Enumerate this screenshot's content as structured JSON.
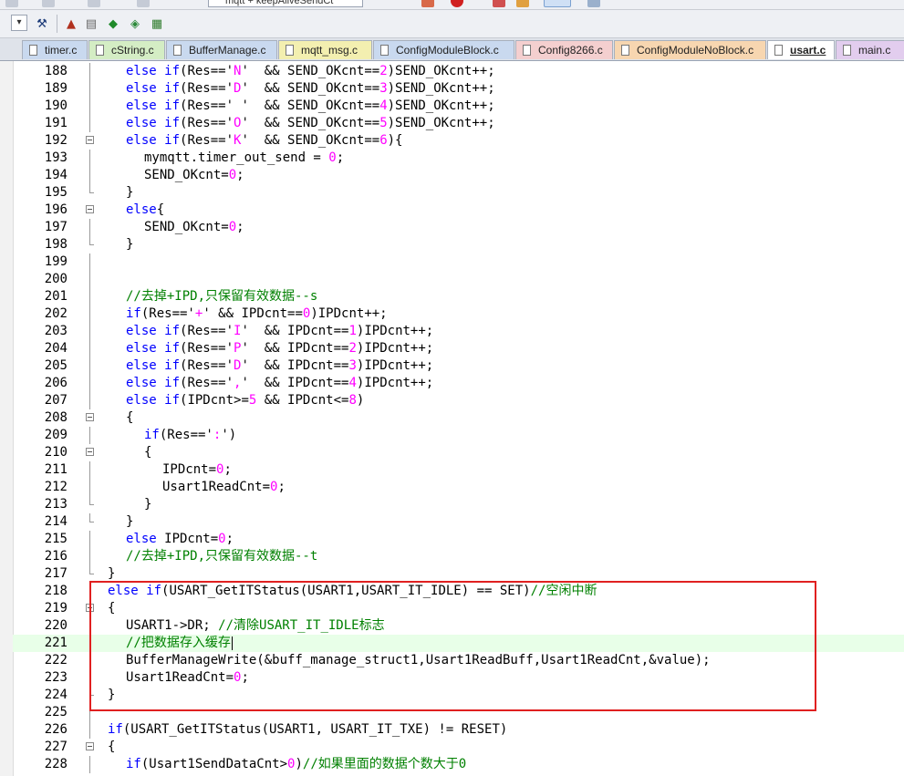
{
  "toolbar_top": {
    "target_combo": "mqtt + keepAliveSendCt"
  },
  "toolbar": {
    "buttons": [
      {
        "name": "dropdown-button",
        "glyph": "▾"
      },
      {
        "name": "options-wand-icon",
        "glyph": "⚒"
      },
      {
        "name": "manage-components-icon",
        "glyph": "▲"
      },
      {
        "name": "file-extensions-icon",
        "glyph": "▤"
      },
      {
        "name": "green-diamond-icon",
        "glyph": "◆"
      },
      {
        "name": "select-packs-icon",
        "glyph": "◈"
      },
      {
        "name": "pack-installer-icon",
        "glyph": "▦"
      }
    ]
  },
  "tabs": [
    {
      "label": "timer.c",
      "color": "#c9d9ef",
      "active": false
    },
    {
      "label": "cString.c",
      "color": "#d4edc4",
      "active": false
    },
    {
      "label": "BufferManage.c",
      "color": "#c9d9ef",
      "active": false
    },
    {
      "label": "mqtt_msg.c",
      "color": "#f3efb0",
      "active": false
    },
    {
      "label": "ConfigModuleBlock.c",
      "color": "#c9d9ef",
      "active": false
    },
    {
      "label": "Config8266.c",
      "color": "#f4cfcf",
      "active": false
    },
    {
      "label": "ConfigModuleNoBlock.c",
      "color": "#f7d6b0",
      "active": false
    },
    {
      "label": "usart.c",
      "color": "#ffffff",
      "active": true
    },
    {
      "label": "main.c",
      "color": "#e2cdee",
      "active": false
    }
  ],
  "colors": {
    "keyword": "#0000ff",
    "number": "#ff00ff",
    "comment": "#008000",
    "highlight_box": "#e02020",
    "current_line": "#e8ffe8"
  },
  "lines": [
    {
      "n": "188",
      "i": 2,
      "f": "v",
      "t": [
        [
          "kw",
          "else if"
        ],
        [
          "tx",
          "(Res=='"
        ],
        [
          "num",
          "N"
        ],
        [
          "tx",
          "'  && SEND_OKcnt=="
        ],
        [
          "num",
          "2"
        ],
        [
          "tx",
          ")SEND_OKcnt++;"
        ]
      ]
    },
    {
      "n": "189",
      "i": 2,
      "f": "v",
      "t": [
        [
          "kw",
          "else if"
        ],
        [
          "tx",
          "(Res=='"
        ],
        [
          "num",
          "D"
        ],
        [
          "tx",
          "'  && SEND_OKcnt=="
        ],
        [
          "num",
          "3"
        ],
        [
          "tx",
          ")SEND_OKcnt++;"
        ]
      ]
    },
    {
      "n": "190",
      "i": 2,
      "f": "v",
      "t": [
        [
          "kw",
          "else if"
        ],
        [
          "tx",
          "(Res=='"
        ],
        [
          "num",
          " "
        ],
        [
          "tx",
          "'  && SEND_OKcnt=="
        ],
        [
          "num",
          "4"
        ],
        [
          "tx",
          ")SEND_OKcnt++;"
        ]
      ]
    },
    {
      "n": "191",
      "i": 2,
      "f": "v",
      "t": [
        [
          "kw",
          "else if"
        ],
        [
          "tx",
          "(Res=='"
        ],
        [
          "num",
          "O"
        ],
        [
          "tx",
          "'  && SEND_OKcnt=="
        ],
        [
          "num",
          "5"
        ],
        [
          "tx",
          ")SEND_OKcnt++;"
        ]
      ]
    },
    {
      "n": "192",
      "i": 2,
      "f": "box",
      "t": [
        [
          "kw",
          "else if"
        ],
        [
          "tx",
          "(Res=='"
        ],
        [
          "num",
          "K"
        ],
        [
          "tx",
          "'  && SEND_OKcnt=="
        ],
        [
          "num",
          "6"
        ],
        [
          "tx",
          "){"
        ]
      ]
    },
    {
      "n": "193",
      "i": 3,
      "f": "v",
      "t": [
        [
          "tx",
          "mymqtt.timer_out_send = "
        ],
        [
          "num",
          "0"
        ],
        [
          "tx",
          ";"
        ]
      ]
    },
    {
      "n": "194",
      "i": 3,
      "f": "v",
      "t": [
        [
          "tx",
          "SEND_OKcnt="
        ],
        [
          "num",
          "0"
        ],
        [
          "tx",
          ";"
        ]
      ]
    },
    {
      "n": "195",
      "i": 2,
      "f": "end",
      "t": [
        [
          "tx",
          "}"
        ]
      ]
    },
    {
      "n": "196",
      "i": 2,
      "f": "box",
      "t": [
        [
          "kw",
          "else"
        ],
        [
          "tx",
          "{"
        ]
      ]
    },
    {
      "n": "197",
      "i": 3,
      "f": "v",
      "t": [
        [
          "tx",
          "SEND_OKcnt="
        ],
        [
          "num",
          "0"
        ],
        [
          "tx",
          ";"
        ]
      ]
    },
    {
      "n": "198",
      "i": 2,
      "f": "end",
      "t": [
        [
          "tx",
          "}"
        ]
      ]
    },
    {
      "n": "199",
      "i": 0,
      "f": "v",
      "t": []
    },
    {
      "n": "200",
      "i": 0,
      "f": "v",
      "t": []
    },
    {
      "n": "201",
      "i": 2,
      "f": "v",
      "t": [
        [
          "cm",
          "//去掉+IPD,只保留有效数据--s"
        ]
      ]
    },
    {
      "n": "202",
      "i": 2,
      "f": "v",
      "t": [
        [
          "kw",
          "if"
        ],
        [
          "tx",
          "(Res=='"
        ],
        [
          "num",
          "+"
        ],
        [
          "tx",
          "' && IPDcnt=="
        ],
        [
          "num",
          "0"
        ],
        [
          "tx",
          ")IPDcnt++;"
        ]
      ]
    },
    {
      "n": "203",
      "i": 2,
      "f": "v",
      "t": [
        [
          "kw",
          "else if"
        ],
        [
          "tx",
          "(Res=='"
        ],
        [
          "num",
          "I"
        ],
        [
          "tx",
          "'  && IPDcnt=="
        ],
        [
          "num",
          "1"
        ],
        [
          "tx",
          ")IPDcnt++;"
        ]
      ]
    },
    {
      "n": "204",
      "i": 2,
      "f": "v",
      "t": [
        [
          "kw",
          "else if"
        ],
        [
          "tx",
          "(Res=='"
        ],
        [
          "num",
          "P"
        ],
        [
          "tx",
          "'  && IPDcnt=="
        ],
        [
          "num",
          "2"
        ],
        [
          "tx",
          ")IPDcnt++;"
        ]
      ]
    },
    {
      "n": "205",
      "i": 2,
      "f": "v",
      "t": [
        [
          "kw",
          "else if"
        ],
        [
          "tx",
          "(Res=='"
        ],
        [
          "num",
          "D"
        ],
        [
          "tx",
          "'  && IPDcnt=="
        ],
        [
          "num",
          "3"
        ],
        [
          "tx",
          ")IPDcnt++;"
        ]
      ]
    },
    {
      "n": "206",
      "i": 2,
      "f": "v",
      "t": [
        [
          "kw",
          "else if"
        ],
        [
          "tx",
          "(Res=='"
        ],
        [
          "num",
          ","
        ],
        [
          "tx",
          "'  && IPDcnt=="
        ],
        [
          "num",
          "4"
        ],
        [
          "tx",
          ")IPDcnt++;"
        ]
      ]
    },
    {
      "n": "207",
      "i": 2,
      "f": "v",
      "t": [
        [
          "kw",
          "else if"
        ],
        [
          "tx",
          "(IPDcnt>="
        ],
        [
          "num",
          "5"
        ],
        [
          "tx",
          " && IPDcnt<="
        ],
        [
          "num",
          "8"
        ],
        [
          "tx",
          ")"
        ]
      ]
    },
    {
      "n": "208",
      "i": 2,
      "f": "box",
      "t": [
        [
          "tx",
          "{"
        ]
      ]
    },
    {
      "n": "209",
      "i": 3,
      "f": "v",
      "t": [
        [
          "kw",
          "if"
        ],
        [
          "tx",
          "(Res=='"
        ],
        [
          "num",
          ":"
        ],
        [
          "tx",
          "')"
        ]
      ]
    },
    {
      "n": "210",
      "i": 3,
      "f": "box",
      "t": [
        [
          "tx",
          "{"
        ]
      ]
    },
    {
      "n": "211",
      "i": 4,
      "f": "v",
      "t": [
        [
          "tx",
          "IPDcnt="
        ],
        [
          "num",
          "0"
        ],
        [
          "tx",
          ";"
        ]
      ]
    },
    {
      "n": "212",
      "i": 4,
      "f": "v",
      "t": [
        [
          "tx",
          "Usart1ReadCnt="
        ],
        [
          "num",
          "0"
        ],
        [
          "tx",
          ";"
        ]
      ]
    },
    {
      "n": "213",
      "i": 3,
      "f": "end",
      "t": [
        [
          "tx",
          "}"
        ]
      ]
    },
    {
      "n": "214",
      "i": 2,
      "f": "end",
      "t": [
        [
          "tx",
          "}"
        ]
      ]
    },
    {
      "n": "215",
      "i": 2,
      "f": "v",
      "t": [
        [
          "kw",
          "else"
        ],
        [
          "tx",
          " IPDcnt="
        ],
        [
          "num",
          "0"
        ],
        [
          "tx",
          ";"
        ]
      ]
    },
    {
      "n": "216",
      "i": 2,
      "f": "v",
      "t": [
        [
          "cm",
          "//去掉+IPD,只保留有效数据--t"
        ]
      ]
    },
    {
      "n": "217",
      "i": 1,
      "f": "end",
      "t": [
        [
          "tx",
          "}"
        ]
      ]
    },
    {
      "n": "218",
      "i": 1,
      "f": "v",
      "t": [
        [
          "kw",
          "else if"
        ],
        [
          "tx",
          "(USART_GetITStatus(USART1,USART_IT_IDLE) == SET)"
        ],
        [
          "cm",
          "//空闲中断"
        ]
      ]
    },
    {
      "n": "219",
      "i": 1,
      "f": "box",
      "t": [
        [
          "tx",
          "{"
        ]
      ]
    },
    {
      "n": "220",
      "i": 2,
      "f": "v",
      "t": [
        [
          "tx",
          "USART1->DR; "
        ],
        [
          "cm",
          "//清除USART_IT_IDLE标志"
        ]
      ]
    },
    {
      "n": "221",
      "i": 2,
      "f": "v",
      "hl": true,
      "caret": true,
      "t": [
        [
          "cm",
          "//把数据存入缓存"
        ]
      ]
    },
    {
      "n": "222",
      "i": 2,
      "f": "v",
      "t": [
        [
          "tx",
          "BufferManageWrite(&buff_manage_struct1,Usart1ReadBuff,Usart1ReadCnt,&value);"
        ]
      ]
    },
    {
      "n": "223",
      "i": 2,
      "f": "v",
      "t": [
        [
          "tx",
          "Usart1ReadCnt="
        ],
        [
          "num",
          "0"
        ],
        [
          "tx",
          ";"
        ]
      ]
    },
    {
      "n": "224",
      "i": 1,
      "f": "end",
      "t": [
        [
          "tx",
          "}"
        ]
      ]
    },
    {
      "n": "225",
      "i": 0,
      "f": "v",
      "t": []
    },
    {
      "n": "226",
      "i": 1,
      "f": "v",
      "t": [
        [
          "kw",
          "if"
        ],
        [
          "tx",
          "(USART_GetITStatus(USART1, USART_IT_TXE) != RESET)"
        ]
      ]
    },
    {
      "n": "227",
      "i": 1,
      "f": "box",
      "t": [
        [
          "tx",
          "{"
        ]
      ]
    },
    {
      "n": "228",
      "i": 2,
      "f": "v",
      "t": [
        [
          "kw",
          "if"
        ],
        [
          "tx",
          "(Usart1SendDataCnt>"
        ],
        [
          "num",
          "0"
        ],
        [
          "tx",
          ")"
        ],
        [
          "cm",
          "//如果里面的数据个数大于0"
        ]
      ]
    }
  ]
}
